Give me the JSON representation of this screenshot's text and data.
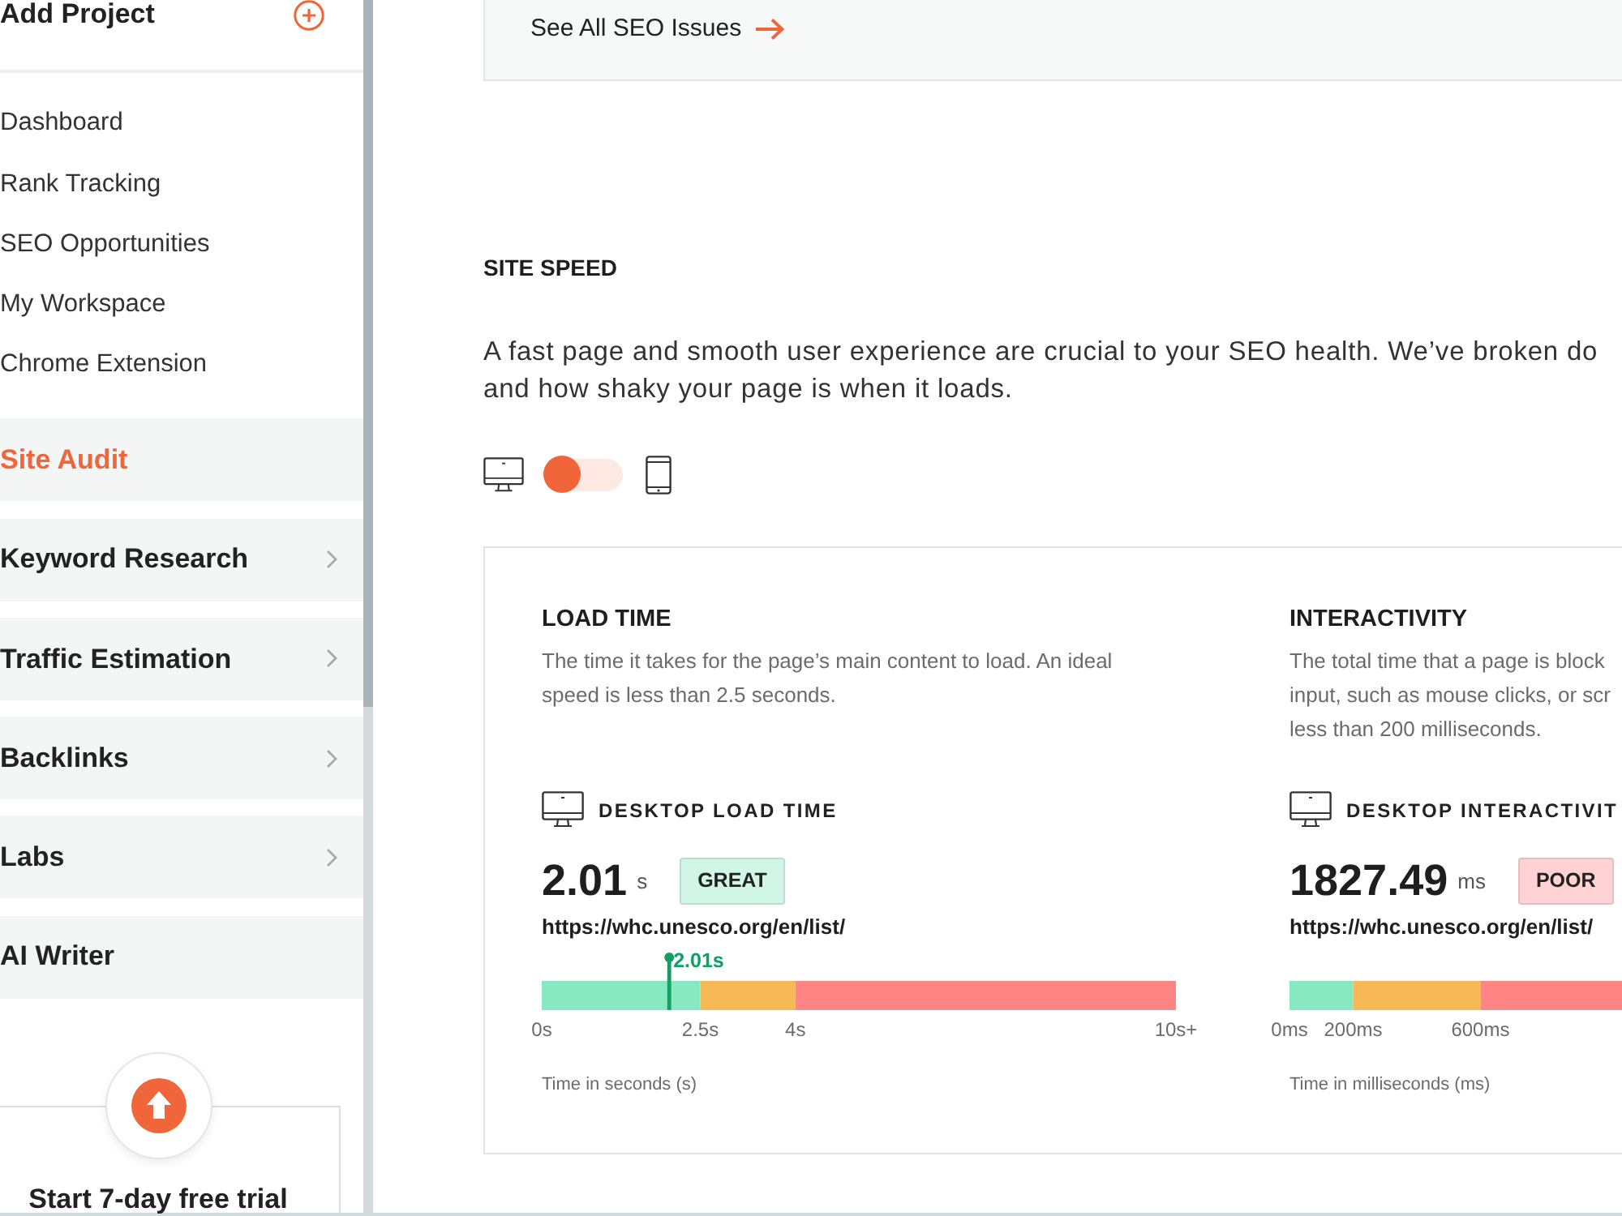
{
  "sidebar": {
    "add_project": {
      "label": "Add Project"
    },
    "items": [
      {
        "kind": "link",
        "label": "Dashboard",
        "selected": false,
        "has_submenu": false
      },
      {
        "kind": "link",
        "label": "Rank Tracking",
        "selected": false,
        "has_submenu": false
      },
      {
        "kind": "link",
        "label": "SEO Opportunities",
        "selected": false,
        "has_submenu": false
      },
      {
        "kind": "link",
        "label": "My Workspace",
        "selected": false,
        "has_submenu": false
      },
      {
        "kind": "link",
        "label": "Chrome Extension",
        "selected": false,
        "has_submenu": false
      },
      {
        "kind": "section",
        "label": "Site Audit",
        "selected": true,
        "has_submenu": false
      },
      {
        "kind": "section",
        "label": "Keyword Research",
        "selected": false,
        "has_submenu": true
      },
      {
        "kind": "section",
        "label": "Traffic Estimation",
        "selected": false,
        "has_submenu": true
      },
      {
        "kind": "section",
        "label": "Backlinks",
        "selected": false,
        "has_submenu": true
      },
      {
        "kind": "section",
        "label": "Labs",
        "selected": false,
        "has_submenu": true
      },
      {
        "kind": "section",
        "label": "AI Writer",
        "selected": false,
        "has_submenu": false
      }
    ],
    "upgrade": {
      "label": "Start 7-day free trial"
    }
  },
  "issues_link": {
    "label": "See All SEO Issues"
  },
  "site_speed": {
    "title": "SITE SPEED",
    "description_lines": [
      "A fast page and smooth user experience are crucial to your SEO health. We’ve broken do",
      "and how shaky your page is when it loads."
    ],
    "device_toggle": {
      "mobile": false
    },
    "metrics": [
      {
        "title": "LOAD TIME",
        "description_lines": [
          "The time it takes for the page’s main content to load. An ideal",
          "speed is less than 2.5 seconds."
        ],
        "device_label": "DESKTOP LOAD TIME",
        "value": "2.01",
        "unit": "s",
        "rating": "GREAT",
        "color": "#d2f6e5",
        "url": "https://whc.unesco.org/en/list/",
        "chart_data": {
          "type": "bar",
          "orientation": "horizontal",
          "stacked": true,
          "categories": [
            null
          ],
          "series": [
            {
              "color": "#86e9c1",
              "values": [
                2.5
              ]
            },
            {
              "color": "#f6b955",
              "values": [
                1.5
              ]
            },
            {
              "color": "#ff8585",
              "values": [
                6
              ]
            }
          ],
          "xlim": [
            0,
            10
          ],
          "xticks": [
            {
              "value": 0,
              "label": "0s"
            },
            {
              "value": 2.5,
              "label": "2.5s"
            },
            {
              "value": 4,
              "label": "4s"
            },
            {
              "value": 10,
              "label": "10s+"
            }
          ],
          "xlabel": "Time in seconds (s)",
          "ref_lines": [
            {
              "axis": "x",
              "value": 2.01,
              "label": "2.01s",
              "color": "#12a062"
            }
          ]
        }
      },
      {
        "title": "INTERACTIVITY",
        "description_lines": [
          "The total time that a page is block",
          "input, such as mouse clicks, or scr",
          "less than 200 milliseconds."
        ],
        "device_label": "DESKTOP INTERACTIVIT",
        "value": "1827.49",
        "unit": "ms",
        "rating": "POOR",
        "color": "#ffd3d3",
        "url": "https://whc.unesco.org/en/list/",
        "chart_data": {
          "type": "bar",
          "orientation": "horizontal",
          "stacked": true,
          "categories": [
            null
          ],
          "series": [
            {
              "color": "#86e9c1",
              "values": [
                200
              ]
            },
            {
              "color": "#f6b955",
              "values": [
                400
              ]
            },
            {
              "color": "#ff8585",
              "values": [
                450
              ]
            }
          ],
          "xlim": [
            0,
            1050
          ],
          "xticks": [
            {
              "value": 0,
              "label": "0ms"
            },
            {
              "value": 200,
              "label": "200ms"
            },
            {
              "value": 600,
              "label": "600ms"
            }
          ],
          "xlabel": "Time in milliseconds (ms)"
        }
      }
    ]
  }
}
